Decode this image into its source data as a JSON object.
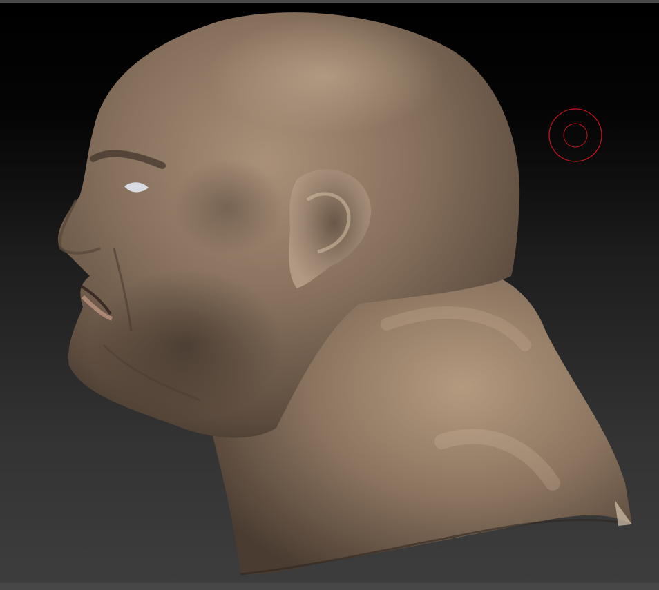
{
  "viewport": {
    "background_top": "#000000",
    "background_bottom": "#3d3d3d"
  },
  "model": {
    "skin_color": "#8a7460",
    "highlight_color": "#b9a287",
    "shadow_color": "#3a2f26"
  },
  "cursor": {
    "icon": "brush-cursor-icon",
    "color": "#c8141c"
  }
}
